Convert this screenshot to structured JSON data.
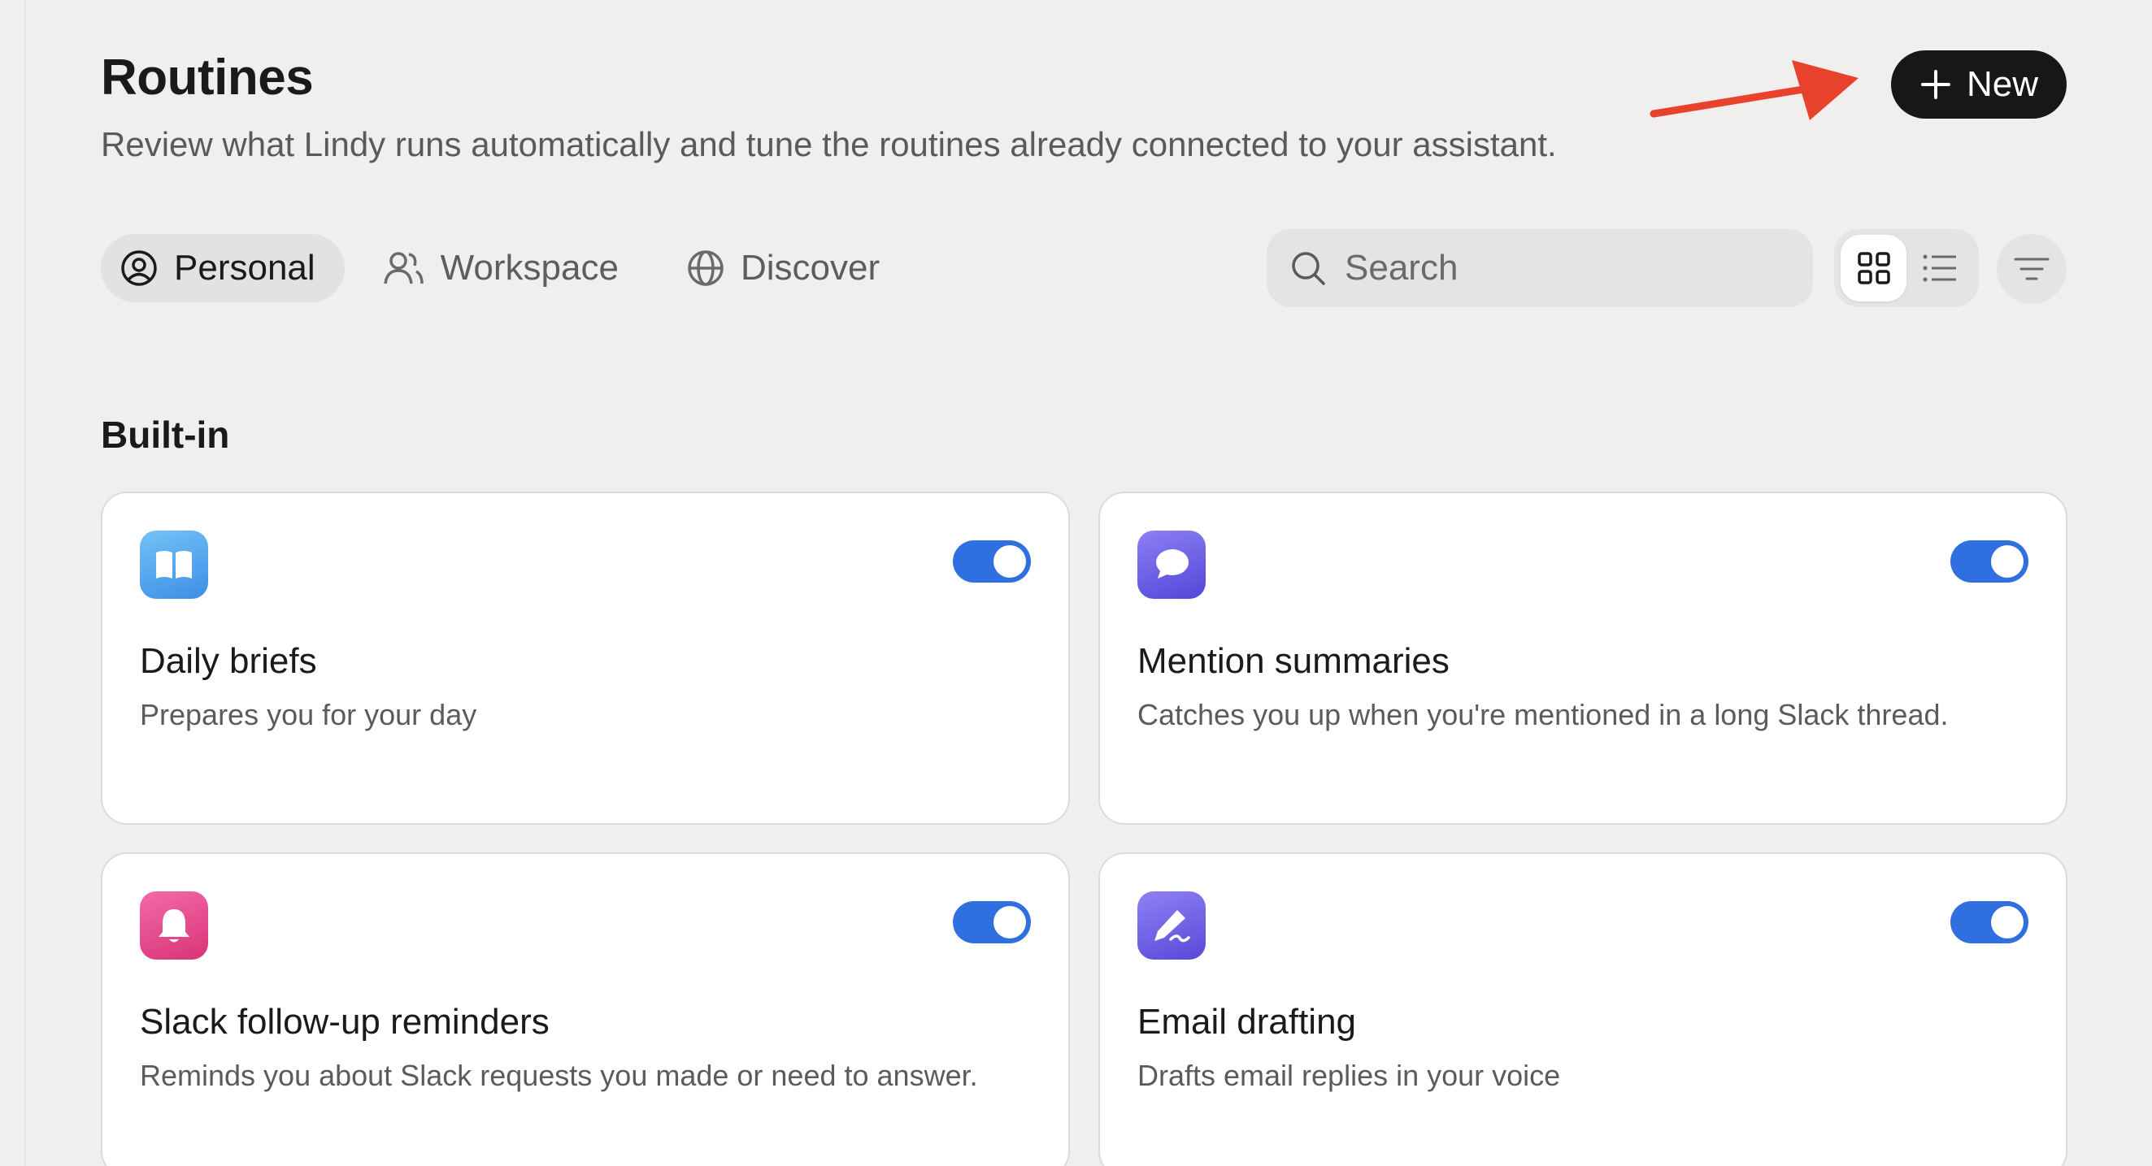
{
  "header": {
    "title": "Routines",
    "subtitle": "Review what Lindy runs automatically and tune the routines already connected to your assistant.",
    "new_button_label": "New"
  },
  "tabs": [
    {
      "label": "Personal",
      "icon": "user-circle-icon",
      "active": true
    },
    {
      "label": "Workspace",
      "icon": "users-icon",
      "active": false
    },
    {
      "label": "Discover",
      "icon": "globe-icon",
      "active": false
    }
  ],
  "search": {
    "placeholder": "Search",
    "value": ""
  },
  "view": {
    "selected": "grid"
  },
  "section": {
    "title": "Built-in"
  },
  "cards": [
    {
      "title": "Daily briefs",
      "description": "Prepares you for your day",
      "icon": "book-icon",
      "enabled": true
    },
    {
      "title": "Mention summaries",
      "description": "Catches you up when you're mentioned in a long Slack thread.",
      "icon": "chat-bubble-icon",
      "enabled": true
    },
    {
      "title": "Slack follow-up reminders",
      "description": "Reminds you about Slack requests you made or need to answer.",
      "icon": "bell-icon",
      "enabled": true
    },
    {
      "title": "Email drafting",
      "description": "Drafts email replies in your voice",
      "icon": "pen-icon",
      "enabled": true
    }
  ],
  "colors": {
    "background": "#f0efee",
    "primary_button": "#171717",
    "toggle_on": "#2f6fe0",
    "annotation_arrow": "#e8412c"
  }
}
